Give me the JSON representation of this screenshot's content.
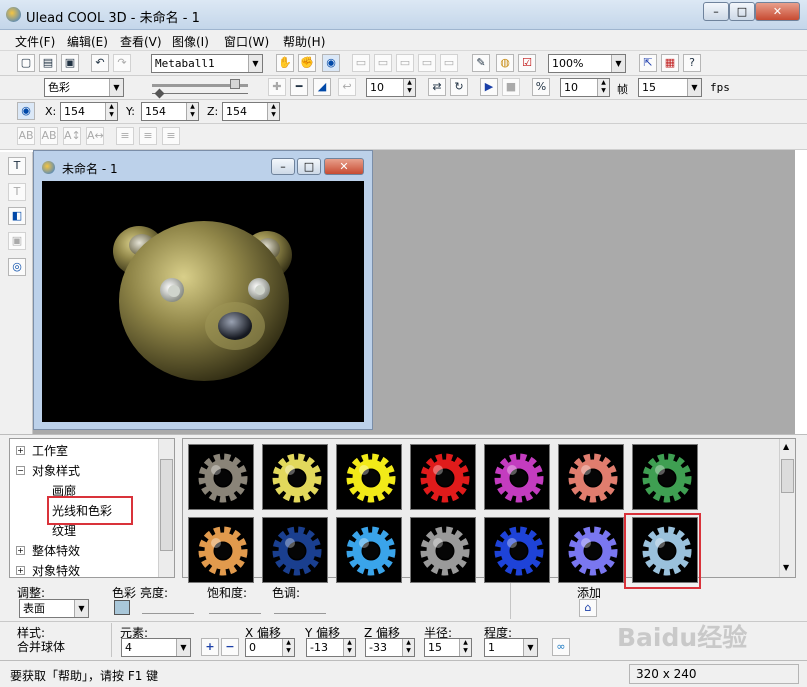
{
  "app": {
    "title": "Ulead COOL 3D - 未命名 - 1"
  },
  "window_controls": {
    "minimize": "–",
    "maximize": "□",
    "close": "✕"
  },
  "menu": [
    "文件(F)",
    "编辑(E)",
    "查看(V)",
    "图像(I)",
    "窗口(W)",
    "帮助(H)"
  ],
  "toolbar": {
    "object_select": "Metaball1",
    "zoom": "100%",
    "frame_value": "10",
    "speed_value": "10",
    "frame_label": "帧",
    "fps_value": "15",
    "fps_label": "fps",
    "color_mode": "色彩"
  },
  "position": {
    "x_label": "X:",
    "x": "154",
    "y_label": "Y:",
    "y": "154",
    "z_label": "Z:",
    "z": "154"
  },
  "document": {
    "title": "未命名 - 1"
  },
  "tree": {
    "items": [
      {
        "label": "工作室",
        "toggle": "+"
      },
      {
        "label": "对象样式",
        "toggle": "−"
      },
      {
        "label": "画廊"
      },
      {
        "label": "光线和色彩"
      },
      {
        "label": "纹理"
      },
      {
        "label": "整体特效",
        "toggle": "+"
      },
      {
        "label": "对象特效",
        "toggle": "+"
      }
    ]
  },
  "gallery": {
    "colors_row1": [
      "#8a8478",
      "#e2d85c",
      "#f2ea18",
      "#e01b1b",
      "#c33cbf",
      "#e07d6e",
      "#3f9f52"
    ],
    "colors_row2": [
      "#e19a4d",
      "#1a3f8f",
      "#3aa4ea",
      "#9a9a9a",
      "#1e43d8",
      "#7a77f0",
      "#9ac1dc"
    ]
  },
  "adjust": {
    "label": "调整:",
    "surface": "表面",
    "color_label": "色彩",
    "brightness_label": "亮度:",
    "saturation_label": "饱和度:",
    "hue_label": "色调:",
    "add_label": "添加"
  },
  "style": {
    "style_label": "样式:",
    "style_value": "合并球体",
    "element_label": "元素:",
    "element_value": "4",
    "x_offset_label": "X 偏移",
    "x_offset": "0",
    "y_offset_label": "Y 偏移",
    "y_offset": "-13",
    "z_offset_label": "Z 偏移",
    "z_offset": "-33",
    "radius_label": "半径:",
    "radius": "15",
    "degree_label": "程度:",
    "degree": "1"
  },
  "status": {
    "help_text": "要获取「帮助」，请按 F1 键",
    "dimensions": "320 x 240"
  },
  "watermark": "Baidu经验"
}
